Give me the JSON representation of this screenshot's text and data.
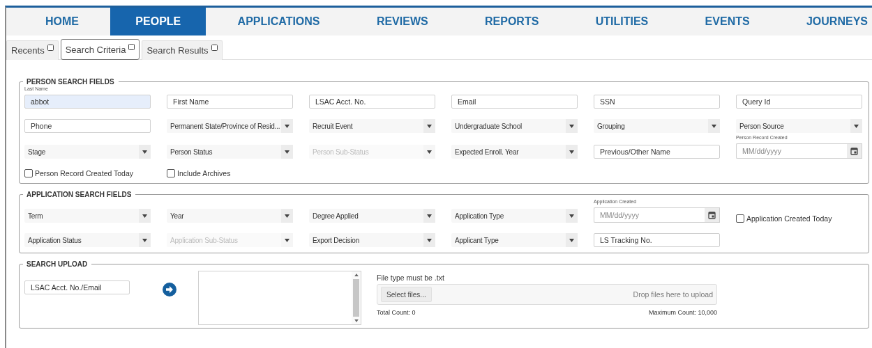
{
  "nav": [
    {
      "label": "HOME",
      "selected": false
    },
    {
      "label": "PEOPLE",
      "selected": true
    },
    {
      "label": "APPLICATIONS",
      "selected": false
    },
    {
      "label": "REVIEWS",
      "selected": false
    },
    {
      "label": "REPORTS",
      "selected": false
    },
    {
      "label": "UTILITIES",
      "selected": false
    },
    {
      "label": "EVENTS",
      "selected": false
    },
    {
      "label": "JOURNEYS",
      "selected": false
    }
  ],
  "tabs": [
    {
      "label": "Recents",
      "selected": false
    },
    {
      "label": "Search Criteria",
      "selected": true
    },
    {
      "label": "Search Results",
      "selected": false
    }
  ],
  "person_search": {
    "title": "PERSON SEARCH FIELDS",
    "fields": [
      {
        "kind": "text",
        "label": "Last Name",
        "value": "abbot"
      },
      {
        "kind": "text",
        "placeholder": "First Name"
      },
      {
        "kind": "text",
        "placeholder": "LSAC Acct. No."
      },
      {
        "kind": "text",
        "placeholder": "Email"
      },
      {
        "kind": "text",
        "placeholder": "SSN"
      },
      {
        "kind": "text",
        "placeholder": "Query Id"
      },
      {
        "kind": "text",
        "placeholder": "Phone"
      },
      {
        "kind": "select",
        "text": "Permanent State/Province of Resid...",
        "disabled": false
      },
      {
        "kind": "select",
        "text": "Recruit Event",
        "disabled": false
      },
      {
        "kind": "select",
        "text": "Undergraduate School",
        "disabled": false
      },
      {
        "kind": "select",
        "text": "Grouping",
        "disabled": false
      },
      {
        "kind": "select",
        "text": "Person Source",
        "disabled": false
      },
      {
        "kind": "select",
        "text": "Stage",
        "disabled": false
      },
      {
        "kind": "select",
        "text": "Person Status",
        "disabled": false
      },
      {
        "kind": "select",
        "text": "Person Sub-Status",
        "disabled": true
      },
      {
        "kind": "select",
        "text": "Expected Enroll. Year",
        "disabled": false
      },
      {
        "kind": "text",
        "placeholder": "Previous/Other Name"
      },
      {
        "kind": "date",
        "label": "Person Record Created",
        "placeholder": "MM/dd/yyyy"
      },
      {
        "kind": "checkbox",
        "label": "Person Record Created Today",
        "checked": false
      },
      {
        "kind": "checkbox",
        "label": "Include Archives",
        "checked": false
      }
    ]
  },
  "application_search": {
    "title": "APPLICATION SEARCH FIELDS",
    "fields": [
      {
        "kind": "select",
        "text": "Term",
        "disabled": false
      },
      {
        "kind": "select",
        "text": "Year",
        "disabled": false
      },
      {
        "kind": "select",
        "text": "Degree Applied",
        "disabled": false
      },
      {
        "kind": "select",
        "text": "Application Type",
        "disabled": false
      },
      {
        "kind": "date",
        "label": "Application Created",
        "placeholder": "MM/dd/yyyy"
      },
      {
        "kind": "checkbox",
        "label": "Application Created Today",
        "checked": false
      },
      {
        "kind": "select",
        "text": "Application Status",
        "disabled": false
      },
      {
        "kind": "select",
        "text": "Application Sub-Status",
        "disabled": true
      },
      {
        "kind": "select",
        "text": "Export Decision",
        "disabled": false
      },
      {
        "kind": "select",
        "text": "Applicant Type",
        "disabled": false
      },
      {
        "kind": "text",
        "placeholder": "LS Tracking No."
      }
    ]
  },
  "search_upload": {
    "title": "SEARCH UPLOAD",
    "id_field": {
      "placeholder": "LSAC Acct. No./Email"
    },
    "file_hint": "File type must be .txt",
    "select_button": "Select files...",
    "drop_hint": "Drop files here to upload",
    "total_count": "Total Count: 0",
    "maximum_count": "Maximum Count: 10,000"
  }
}
